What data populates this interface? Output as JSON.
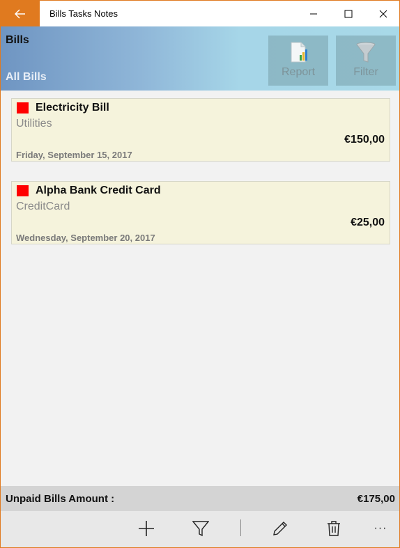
{
  "window": {
    "title": "Bills Tasks Notes",
    "accent": "#e07a1f"
  },
  "header": {
    "title": "Bills",
    "subtitle": "All Bills",
    "report_label": "Report",
    "filter_label": "Filter"
  },
  "bills": [
    {
      "name": "Electricity Bill",
      "category": "Utilities",
      "amount": "€150,00",
      "date": "Friday, September 15, 2017",
      "status_color": "#ff0000"
    },
    {
      "name": "Alpha Bank Credit Card",
      "category": "CreditCard",
      "amount": "€25,00",
      "date": "Wednesday, September 20, 2017",
      "status_color": "#ff0000"
    }
  ],
  "summary": {
    "label": "Unpaid Bills Amount :",
    "amount": "€175,00"
  },
  "appbar": {
    "icons": [
      "add-icon",
      "filter-icon",
      "edit-icon",
      "delete-icon",
      "more-icon"
    ],
    "more_label": "···"
  }
}
